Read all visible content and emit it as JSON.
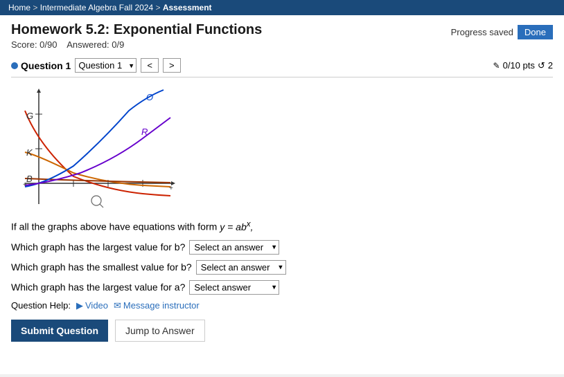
{
  "nav": {
    "items": [
      "Home",
      "Intermediate Algebra Fall 2024",
      "Assessment"
    ],
    "separators": [
      " > ",
      " > "
    ]
  },
  "header": {
    "title": "Homework 5.2: Exponential Functions",
    "score_label": "Score: 0/90",
    "answered_label": "Answered: 0/9",
    "progress_saved": "Progress saved",
    "done_label": "Done"
  },
  "question": {
    "label": "Question 1",
    "nav_prev": "<",
    "nav_next": ">",
    "pts": "0/10 pts",
    "retry_icon": "↺",
    "retry_count": "2"
  },
  "problem": {
    "intro": "If all the graphs above have equations with form",
    "formula": "y = abˣ,",
    "q1": "Which graph has the largest value for b?",
    "q2": "Which graph has the smallest value for b?",
    "q3": "Which graph has the largest value for a?",
    "select_placeholder": "Select an answer",
    "select_placeholder2": "Select an answer",
    "select_placeholder3": "Select answer",
    "help_label": "Question Help:",
    "video_label": "Video",
    "message_label": "Message instructor"
  },
  "buttons": {
    "submit": "Submit Question",
    "jump": "Jump to Answer"
  },
  "graph": {
    "labels": [
      "G",
      "K",
      "B",
      "O",
      "R"
    ],
    "axis_x": "x-axis",
    "axis_y": "y-axis"
  }
}
